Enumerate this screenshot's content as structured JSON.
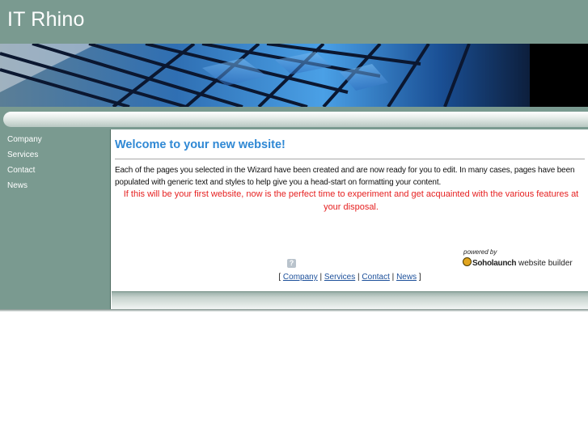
{
  "site": {
    "title": "IT Rhino"
  },
  "sidebar": {
    "items": [
      {
        "label": "Company"
      },
      {
        "label": "Services"
      },
      {
        "label": "Contact"
      },
      {
        "label": "News"
      }
    ]
  },
  "main": {
    "heading": "Welcome to your new website!",
    "paragraph": "Each of the pages you selected in the Wizard have been created and are now ready for you to edit. In many cases, pages have been populated with generic text and styles to help give you a head-start on formatting your content.",
    "highlight": "If this will be your first website, now is the perfect time to experiment and get acquainted with the various features at your disposal."
  },
  "help_icon": {
    "glyph": "?"
  },
  "branding": {
    "powered_by": "powered by",
    "brand": "Soholaunch",
    "suffix": "website builder"
  },
  "footer": {
    "open_bracket": "[",
    "close_bracket": "]",
    "separator": "|",
    "links": [
      {
        "label": "Company"
      },
      {
        "label": "Services"
      },
      {
        "label": "Contact"
      },
      {
        "label": "News"
      }
    ]
  },
  "colors": {
    "header_bg": "#7a9a90",
    "heading_blue": "#2f88d4",
    "highlight_red": "#e62121"
  }
}
